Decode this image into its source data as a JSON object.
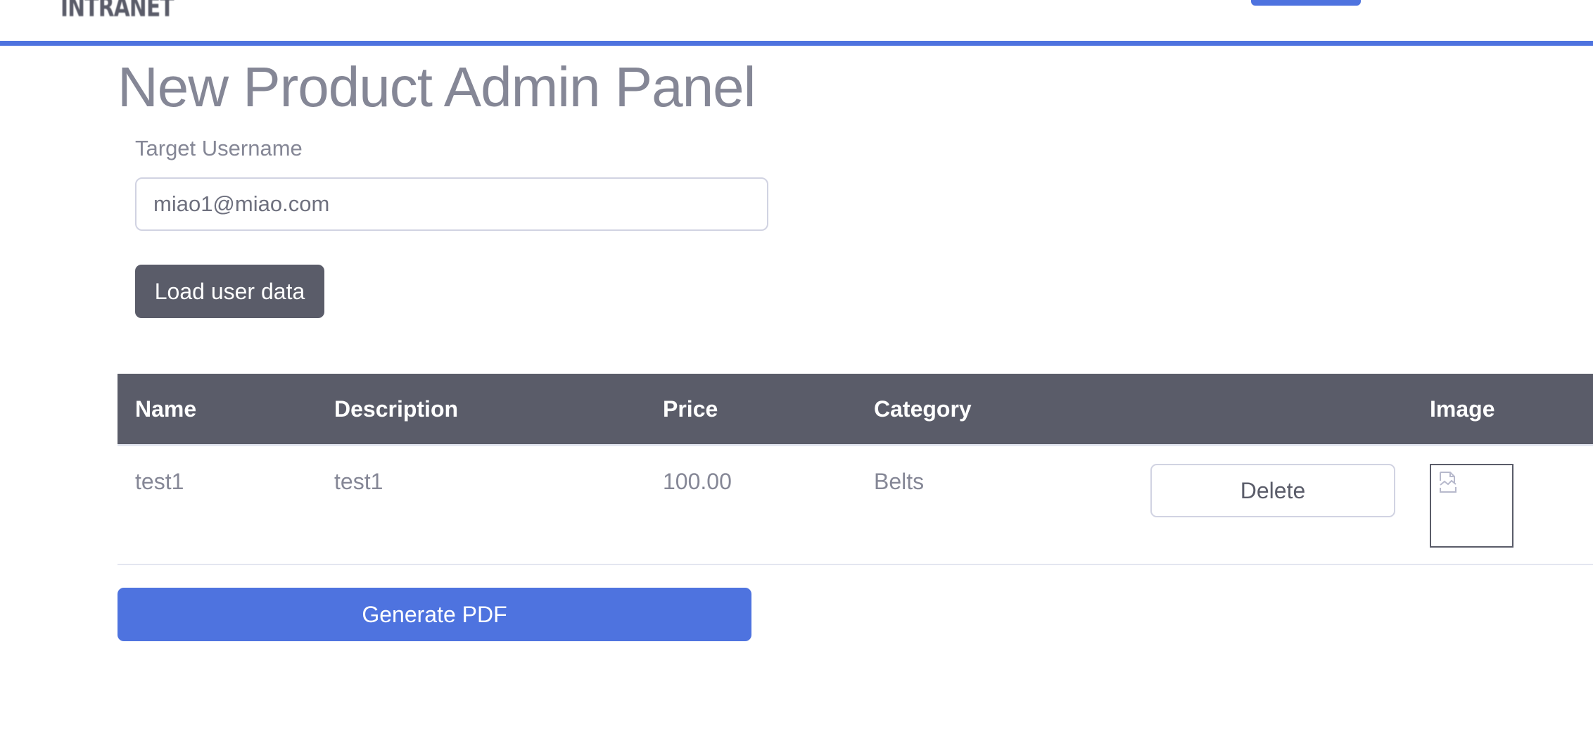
{
  "header": {
    "brand": "INTRANET",
    "accent_color": "#4e73df"
  },
  "main": {
    "title": "New Product Admin Panel",
    "username_label": "Target Username",
    "username_value": "miao1@miao.com",
    "load_button": "Load user data",
    "generate_pdf_button": "Generate PDF"
  },
  "table": {
    "headers": [
      "Name",
      "Description",
      "Price",
      "Category",
      "",
      "Image"
    ],
    "rows": [
      {
        "name": "test1",
        "description": "test1",
        "price": "100.00",
        "category": "Belts",
        "action": "Delete",
        "image_icon": "broken-image-icon"
      }
    ]
  }
}
